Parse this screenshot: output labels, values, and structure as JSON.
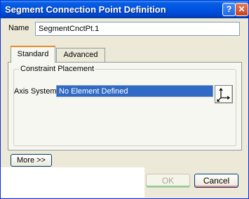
{
  "window": {
    "title": "Segment Connection Point Definition",
    "help_glyph": "?",
    "close_glyph": "✕"
  },
  "name_row": {
    "label": "Name",
    "value": "SegmentCnctPt.1"
  },
  "tabs": [
    {
      "label": "Standard",
      "active": true
    },
    {
      "label": "Advanced",
      "active": false
    }
  ],
  "constraint_group": {
    "title": "Constraint Placement",
    "axis_label": "Axis System",
    "axis_value": "No Element Defined",
    "axis_button_icon": "axis-system-icon"
  },
  "buttons": {
    "more": "More >>",
    "ok": "OK",
    "cancel": "Cancel"
  },
  "colors": {
    "titlebar": "#0054e3",
    "selection": "#316ac5",
    "ok_disabled_text": "#aca899"
  }
}
